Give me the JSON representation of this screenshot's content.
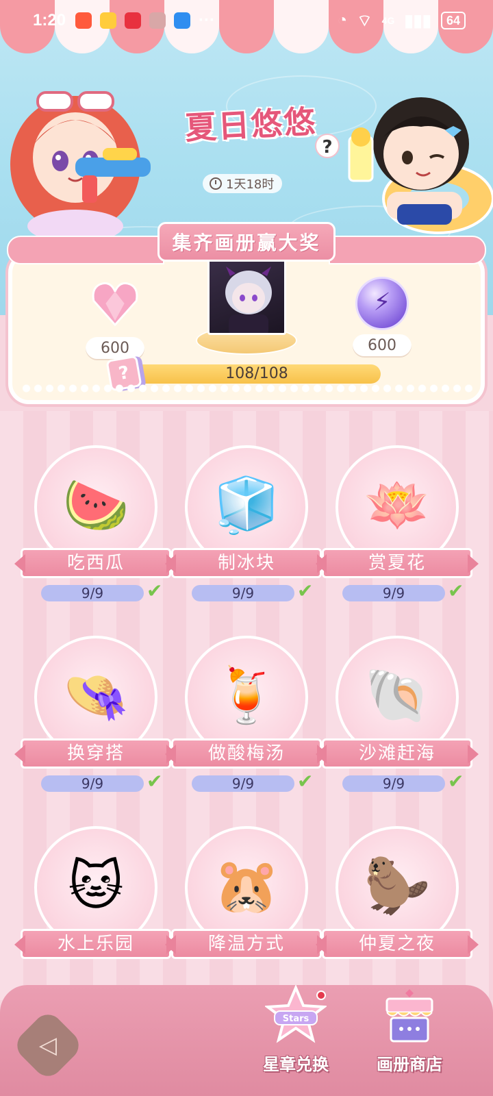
{
  "status_bar": {
    "time": "1:20",
    "more": "···",
    "network": "4G",
    "battery": "64"
  },
  "event": {
    "title": "夏日悠悠",
    "help": "?",
    "countdown": "1天18时"
  },
  "reward_panel": {
    "ribbon": "集齐画册赢大奖",
    "left_reward_amount": "600",
    "right_reward_amount": "600",
    "progress_text": "108/108",
    "progress_fraction": 1.0,
    "card_icon_glyph": "?"
  },
  "albums": [
    {
      "label": "吃西瓜",
      "count": "9/9",
      "icon": "🍉",
      "complete": true
    },
    {
      "label": "制冰块",
      "count": "9/9",
      "icon": "🧊",
      "complete": true
    },
    {
      "label": "赏夏花",
      "count": "9/9",
      "icon": "🪷",
      "complete": true
    },
    {
      "label": "换穿搭",
      "count": "9/9",
      "icon": "👒",
      "complete": true
    },
    {
      "label": "做酸梅汤",
      "count": "9/9",
      "icon": "🍹",
      "complete": true
    },
    {
      "label": "沙滩赶海",
      "count": "9/9",
      "icon": "🐚",
      "complete": true
    },
    {
      "label": "水上乐园",
      "icon": "🐱"
    },
    {
      "label": "降温方式",
      "icon": "🐹"
    },
    {
      "label": "仲夏之夜",
      "icon": "🦫"
    }
  ],
  "bottom_bar": {
    "back_glyph": "◁",
    "exchange_label": "星章兑换",
    "shop_label": "画册商店",
    "exchange_badge_text": "Stars"
  },
  "colors": {
    "accent_pink": "#ec8ba1",
    "title_pink": "#e5577a",
    "progress_yellow": "#f7c14a",
    "check_green": "#78c44d"
  }
}
